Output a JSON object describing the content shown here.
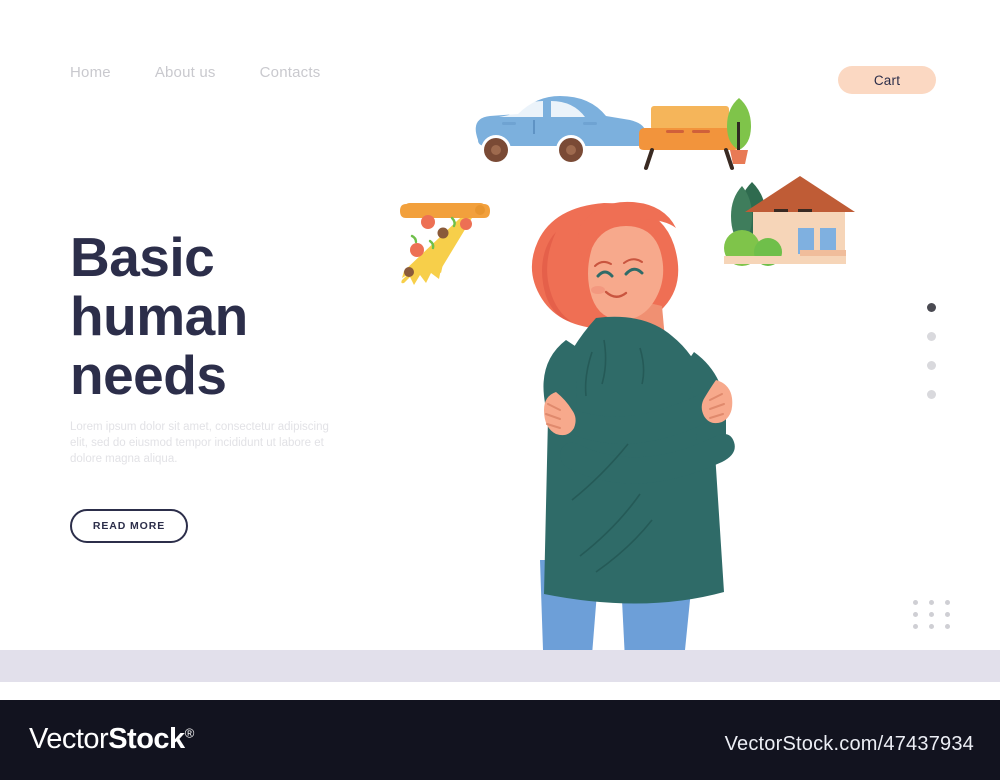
{
  "header": {
    "nav_items": [
      {
        "label": "Home"
      },
      {
        "label": "About us"
      },
      {
        "label": "Contacts"
      }
    ],
    "cart_label": "Cart",
    "cart_bg": "#fbd8c2"
  },
  "hero": {
    "title_line1": "Basic",
    "title_line2": "human",
    "title_line3": "needs",
    "title_color": "#2c2e4a",
    "paragraph": "Lorem ipsum dolor sit amet, consectetur adipiscing elit, sed do eiusmod tempor incididunt ut labore et dolore magna aliqua.",
    "cta_label": "READ MORE"
  },
  "carousel": {
    "dots": [
      {
        "active": true
      },
      {
        "active": false
      },
      {
        "active": false
      },
      {
        "active": false
      }
    ],
    "active_color": "#4a4a52",
    "inactive_color": "#d9d9dd"
  },
  "decor": {
    "dot_grid_rows": 3,
    "dot_grid_cols": 3,
    "dot_grid_color": "#cfcfd4",
    "ground_band_color": "#e2e0eb"
  },
  "illustration": {
    "items": [
      {
        "name": "car-illustration",
        "body_color": "#7cb0dd",
        "wheel_color": "#7a4a35"
      },
      {
        "name": "bench-illustration",
        "seat_color": "#f2a03c",
        "back_color": "#f5b55a",
        "leg_color": "#3a2a22"
      },
      {
        "name": "potted-plant-illustration",
        "leaf_color": "#7fc44a",
        "pot_color": "#e87a55"
      },
      {
        "name": "pizza-slice-illustration",
        "cheese_color": "#f7cf4a",
        "crust_color": "#f2a03c",
        "pepperoni_color": "#ed7054",
        "olive_color": "#8a5a3a",
        "herb_color": "#6fbf4a"
      },
      {
        "name": "house-illustration",
        "roof_color": "#bf5c36",
        "wall_color": "#f6d5b8",
        "window_color": "#7fb0e0",
        "tree_color": "#2f6b4f",
        "bush_color": "#7fc44a"
      },
      {
        "name": "woman-hugging-herself-illustration",
        "hair_color": "#ef6f54",
        "skin_color": "#f7a98c",
        "sweater_color": "#2f6b68",
        "jeans_color": "#6d9fd8"
      }
    ]
  },
  "watermark": {
    "brand_light": "Vector",
    "brand_bold": "Stock",
    "registered": "®",
    "url": "VectorStock.com/47437934",
    "footer_color": "#12131f"
  }
}
